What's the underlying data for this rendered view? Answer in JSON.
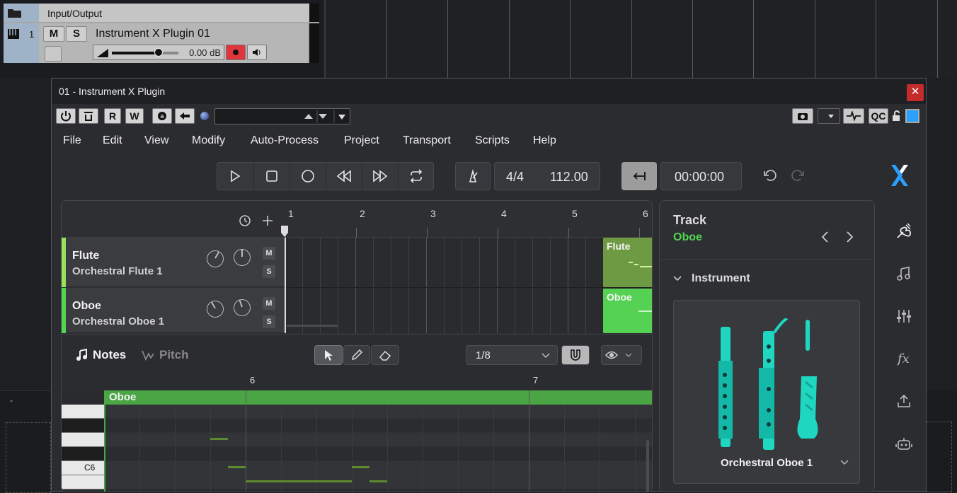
{
  "host": {
    "folder_label": "Input/Output",
    "track_number": "1",
    "mute_label": "M",
    "solo_label": "S",
    "track_name": "Instrument X Plugin 01",
    "volume": "0.00 dB",
    "volume_level": 0.7,
    "status_dash": "-"
  },
  "window": {
    "title": "01 - Instrument X Plugin",
    "close_glyph": "✕"
  },
  "toolbar": {
    "read_label": "R",
    "write_label": "W",
    "qc_label": "QC",
    "preset_value": ""
  },
  "menu": [
    "File",
    "Edit",
    "View",
    "Modify",
    "Auto-Process",
    "Project",
    "Transport",
    "Scripts",
    "Help"
  ],
  "transport": {
    "time_signature": "4/4",
    "tempo": "112.00",
    "time": "00:00:00"
  },
  "ruler": [
    "1",
    "2",
    "3",
    "4",
    "5",
    "6"
  ],
  "tracks": [
    {
      "name": "Flute",
      "instrument": "Orchestral Flute 1",
      "color": "#9be05a",
      "mute": "M",
      "solo": "S",
      "clip": "Flute",
      "clip_color": "#6f9a44"
    },
    {
      "name": "Oboe",
      "instrument": "Orchestral Oboe 1",
      "color": "#53d652",
      "mute": "M",
      "solo": "S",
      "clip": "Oboe",
      "clip_color": "#55d153"
    }
  ],
  "editor": {
    "notes_tab": "Notes",
    "pitch_tab": "Pitch",
    "quantize": "1/8",
    "bar_labels": [
      "6",
      "7"
    ],
    "region_label": "Oboe",
    "key_label": "C6"
  },
  "inspector": {
    "heading": "Track",
    "track_name": "Oboe",
    "section": "Instrument",
    "instrument_name": "Orchestral Oboe 1"
  },
  "colors": {
    "accent_green": "#53d652",
    "record_red": "#e0353a",
    "brand_blue": "#2aa0ff",
    "instrument_teal": "#1fd6c0"
  }
}
